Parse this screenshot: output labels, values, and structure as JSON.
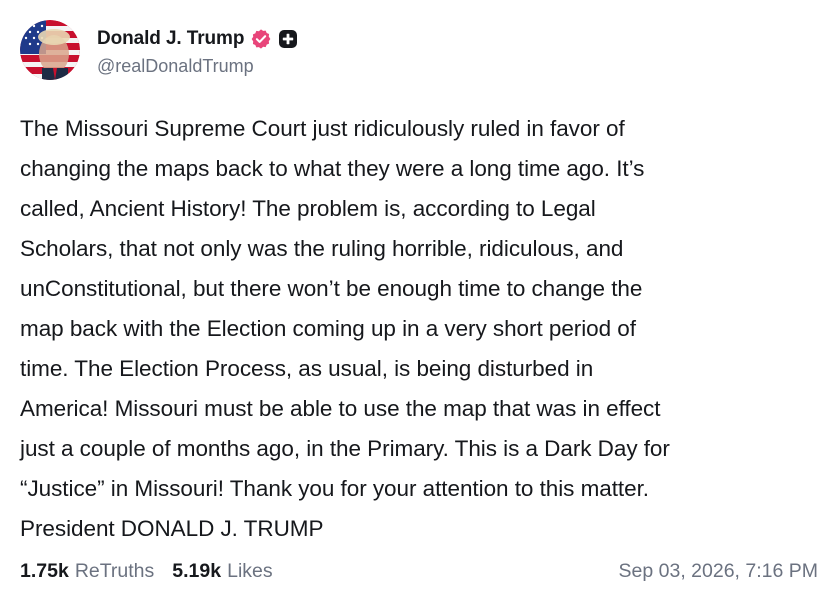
{
  "author": {
    "display_name": "Donald J. Trump",
    "handle": "@realDonaldTrump",
    "avatar_icon": "portrait-flag-avatar",
    "verified_icon": "verified-badge-icon",
    "verified_color": "#e8457a",
    "plus_icon": "plus-badge-icon"
  },
  "post": {
    "text": "The Missouri Supreme Court just ridiculously ruled in favor of\nchanging the maps back to what they were a long time ago. It’s\ncalled, Ancient History! The problem is, according to Legal\nScholars, that not only was the ruling horrible, ridiculous, and\nunConstitutional, but there won’t be enough time to change the\nmap back with the Election coming up in a very short period of\ntime. The Election Process, as usual, is being disturbed in\nAmerica! Missouri must be able to use the map that was in effect\njust a couple of months ago, in the Primary. This is a Dark Day for\n“Justice” in Missouri! Thank you for your attention to this matter.\nPresident DONALD J. TRUMP"
  },
  "stats": {
    "retruths_count": "1.75k",
    "retruths_label": "ReTruths",
    "likes_count": "5.19k",
    "likes_label": "Likes"
  },
  "timestamp": "Sep 03, 2026, 7:16 PM"
}
